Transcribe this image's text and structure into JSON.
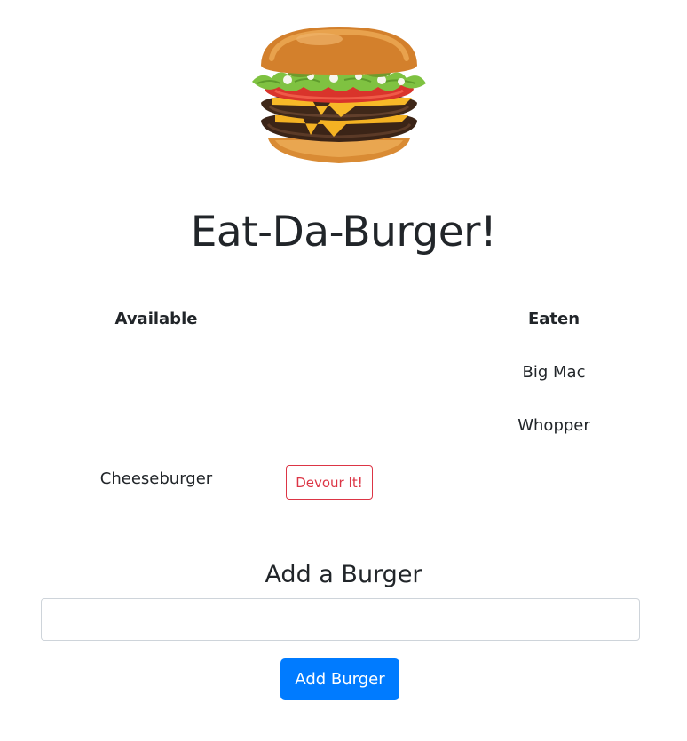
{
  "hero": {
    "image_name": "burger-image"
  },
  "title": "Eat-Da-Burger!",
  "table": {
    "headers": {
      "available": "Available",
      "eaten": "Eaten"
    },
    "eaten": [
      "Big Mac",
      "Whopper"
    ],
    "available": [
      {
        "name": "Cheeseburger",
        "button_label": "Devour It!"
      }
    ]
  },
  "add_form": {
    "heading": "Add a Burger",
    "input_value": "",
    "input_placeholder": "",
    "button_label": "Add Burger"
  },
  "colors": {
    "text": "#212529",
    "danger": "#dc3545",
    "primary": "#007bff",
    "input_border": "#ced4da"
  }
}
